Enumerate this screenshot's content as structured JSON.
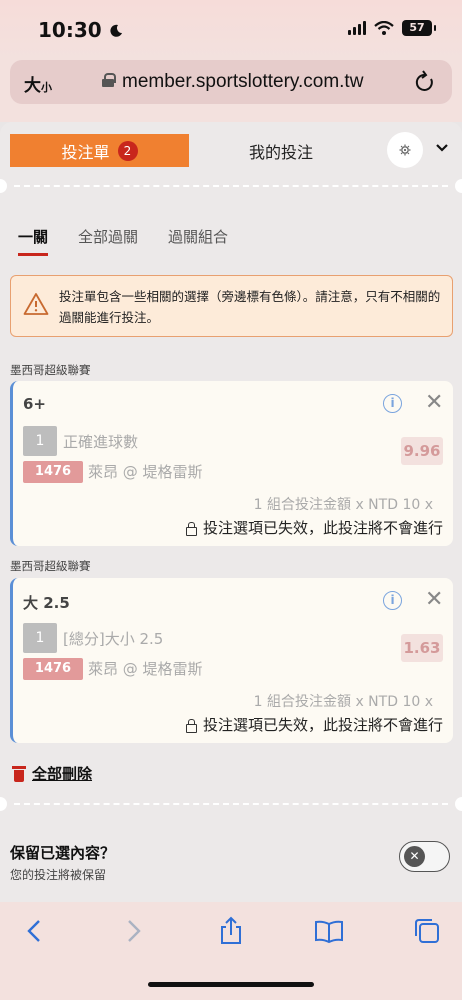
{
  "status_bar": {
    "time": "10:30",
    "battery": "57"
  },
  "browser": {
    "text_size_label": "大",
    "text_size_small": "小",
    "url": "member.sportslottery.com.tw"
  },
  "tabs": {
    "bet_slip_label": "投注單",
    "bet_slip_count": "2",
    "my_bets_label": "我的投注"
  },
  "subtabs": [
    "一關",
    "全部過關",
    "過關組合"
  ],
  "warning": {
    "text": "投注單包含一些相關的選擇（旁邊標有色條）。請注意，只有不相關的過關能進行投注。"
  },
  "bets": [
    {
      "league": "墨西哥超級聯賽",
      "selection": "6+",
      "index": "1",
      "market": "正確進球數",
      "odds": "9.96",
      "match_code": "1476",
      "match": "萊昂 @ 堤格雷斯",
      "combo_text": "1 組合投注金額 x NTD 10 x",
      "status": "投注選項已失效，此投注將不會進行"
    },
    {
      "league": "墨西哥超級聯賽",
      "selection": "大 2.5",
      "index": "1",
      "market": "[總分]大小 2.5",
      "odds": "1.63",
      "match_code": "1476",
      "match": "萊昂 @ 堤格雷斯",
      "combo_text": "1 組合投注金額 x NTD 10 x",
      "status": "投注選項已失效，此投注將不會進行"
    }
  ],
  "delete_all_label": "全部刪除",
  "keep_selection": {
    "title": "保留已選內容？",
    "subtitle": "您的投注將被保留",
    "enabled": false
  },
  "colors": {
    "accent_orange": "#f08030",
    "badge_red": "#c8261c",
    "correlated_bar_blue": "#5b8fd6",
    "ios_blue": "#2f6fd6"
  },
  "icons": [
    "moon-icon",
    "signal-icon",
    "wifi-icon",
    "battery-icon",
    "lock-icon",
    "reload-icon",
    "gear-icon",
    "chevron-down-icon",
    "warning-icon",
    "info-icon",
    "close-icon",
    "padlock-icon",
    "trash-icon",
    "back-icon",
    "forward-icon",
    "share-icon",
    "bookmarks-icon",
    "tabs-icon"
  ]
}
